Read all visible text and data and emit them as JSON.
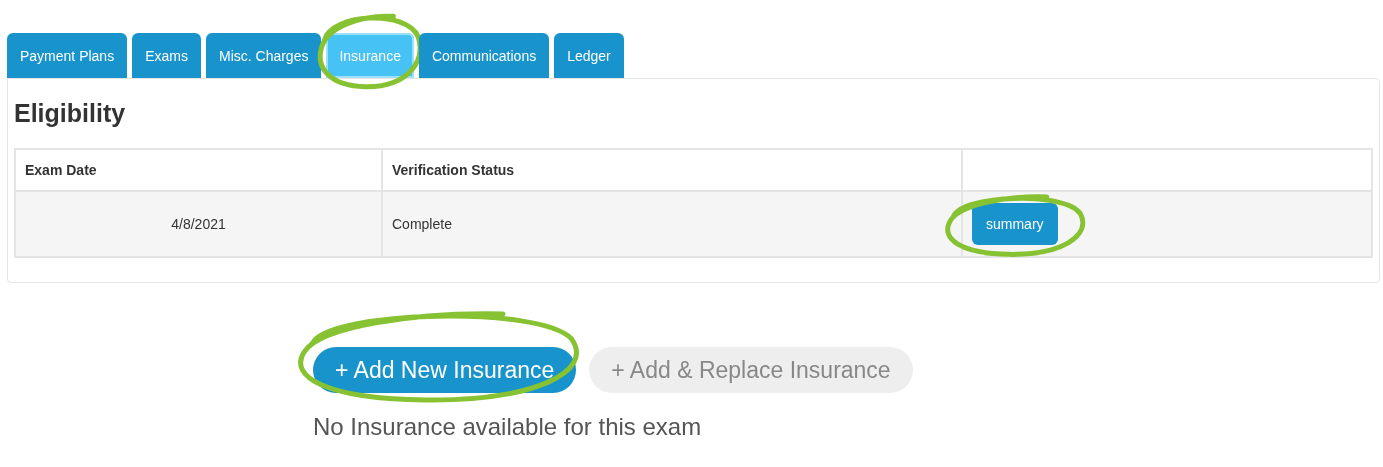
{
  "tabs": [
    {
      "label": "Payment Plans",
      "selected": false,
      "highlighted": false
    },
    {
      "label": "Exams",
      "selected": false,
      "highlighted": false
    },
    {
      "label": "Misc. Charges",
      "selected": false,
      "highlighted": false
    },
    {
      "label": "Insurance",
      "selected": true,
      "highlighted": true
    },
    {
      "label": "Communications",
      "selected": false,
      "highlighted": false
    },
    {
      "label": "Ledger",
      "selected": false,
      "highlighted": false
    }
  ],
  "section_title": "Eligibility",
  "table": {
    "columns": [
      "Exam Date",
      "Verification Status"
    ],
    "rows": [
      {
        "exam_date": "4/8/2021",
        "status": "Complete",
        "action": "summary",
        "action_highlighted": true
      }
    ]
  },
  "buttons": [
    {
      "label": "+ Add New Insurance",
      "disabled": false,
      "highlighted": true
    },
    {
      "label": "+ Add & Replace Insurance",
      "disabled": true,
      "highlighted": false
    }
  ],
  "message": "No Insurance available for this exam"
}
